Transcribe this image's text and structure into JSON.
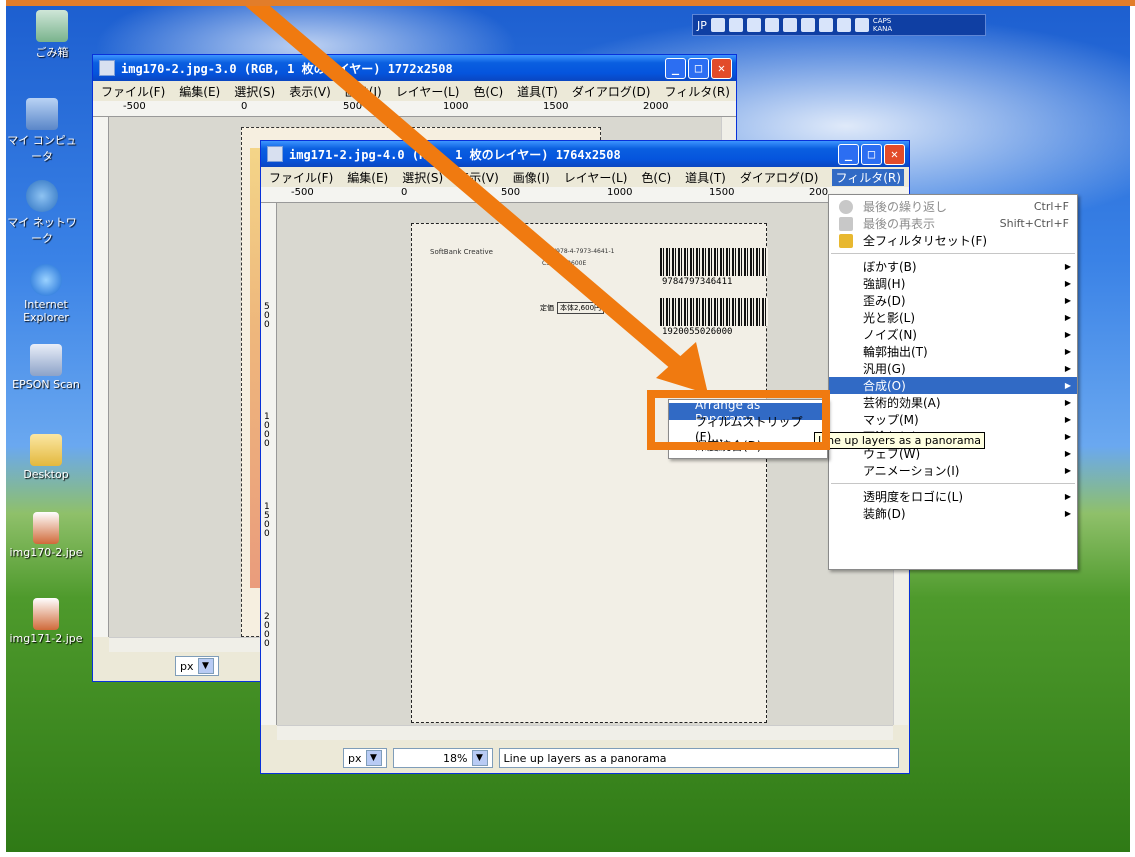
{
  "colors": {
    "highlight": "#f07a10",
    "titlebar": "#0554dd",
    "menu_highlight": "#316ac5"
  },
  "langbar": {
    "lang": "JP",
    "caps_line1": "CAPS",
    "caps_line2": "KANA"
  },
  "desktop_icons": [
    {
      "label": "ごみ箱",
      "icon": "recycle-bin-icon"
    },
    {
      "label": "マイ コンピュータ",
      "icon": "my-computer-icon"
    },
    {
      "label": "マイ ネットワーク",
      "icon": "network-icon"
    },
    {
      "label": "Internet Explorer",
      "icon": "internet-explorer-icon"
    },
    {
      "label": "EPSON Scan",
      "icon": "epson-scan-icon"
    },
    {
      "label": "Desktop",
      "icon": "folder-icon"
    },
    {
      "label": "img170-2.jpe",
      "icon": "image-file-icon"
    },
    {
      "label": "img171-2.jpe",
      "icon": "image-file-icon"
    }
  ],
  "window_back": {
    "title": "img170-2.jpg-3.0 (RGB, 1 枚のレイヤー) 1772x2508",
    "menu": [
      "ファイル(F)",
      "編集(E)",
      "選択(S)",
      "表示(V)",
      "画像(I)",
      "レイヤー(L)",
      "色(C)",
      "道具(T)",
      "ダイアログ(D)",
      "フィルタ(R)"
    ],
    "ruler": [
      "-500",
      "0",
      "500",
      "1000",
      "1500",
      "2000"
    ],
    "unit": "px"
  },
  "window_front": {
    "title": "img171-2.jpg-4.0 (RGB, 1 枚のレイヤー) 1764x2508",
    "menu": [
      "ファイル(F)",
      "編集(E)",
      "選択(S)",
      "表示(V)",
      "画像(I)",
      "レイヤー(L)",
      "色(C)",
      "道具(T)",
      "ダイアログ(D)",
      "フィルタ(R)"
    ],
    "ruler": [
      "-500",
      "0",
      "500",
      "1000",
      "1500",
      "200"
    ],
    "ruler_v": [
      "5 0 0",
      "1 0 0 0",
      "1 5 0 0",
      "2 0 0 0"
    ],
    "unit": "px",
    "zoom": "18%",
    "status": "Line up layers as a panorama"
  },
  "page": {
    "publisher": "SoftBank Creative",
    "isbn_text": "ISBN978-4-7973-4641-1",
    "code_text": "C3055 ¥2600E",
    "price_label": "定価",
    "price_box": "本体2,600円",
    "price_suffix": "+税",
    "barcode1": "9784797346411",
    "barcode2": "1920055026000"
  },
  "filter_menu": {
    "items_top": [
      {
        "label": "最後の繰り返し",
        "accel": "Ctrl+F",
        "disabled": true
      },
      {
        "label": "最後の再表示",
        "accel": "Shift+Ctrl+F",
        "disabled": true
      },
      {
        "label": "全フィルタリセット(F)",
        "accel": "",
        "disabled": false
      }
    ],
    "items_mid": [
      "ぼかす(B)",
      "強調(H)",
      "歪み(D)",
      "光と影(L)",
      "ノイズ(N)",
      "輪郭抽出(T)",
      "汎用(G)",
      "合成(O)",
      "芸術的効果(A)",
      "マップ(M)",
      "下塗り(R)",
      "ウェブ(W)",
      "アニメーション(I)"
    ],
    "items_bottom": [
      "透明度をロゴに(L)",
      "装飾(D)"
    ]
  },
  "submenu": {
    "items": [
      "Arrange as Panorama...",
      "フィルムストリップ(F)...",
      "深度統合(D)..."
    ]
  },
  "tooltip": "Line up layers as a panorama"
}
